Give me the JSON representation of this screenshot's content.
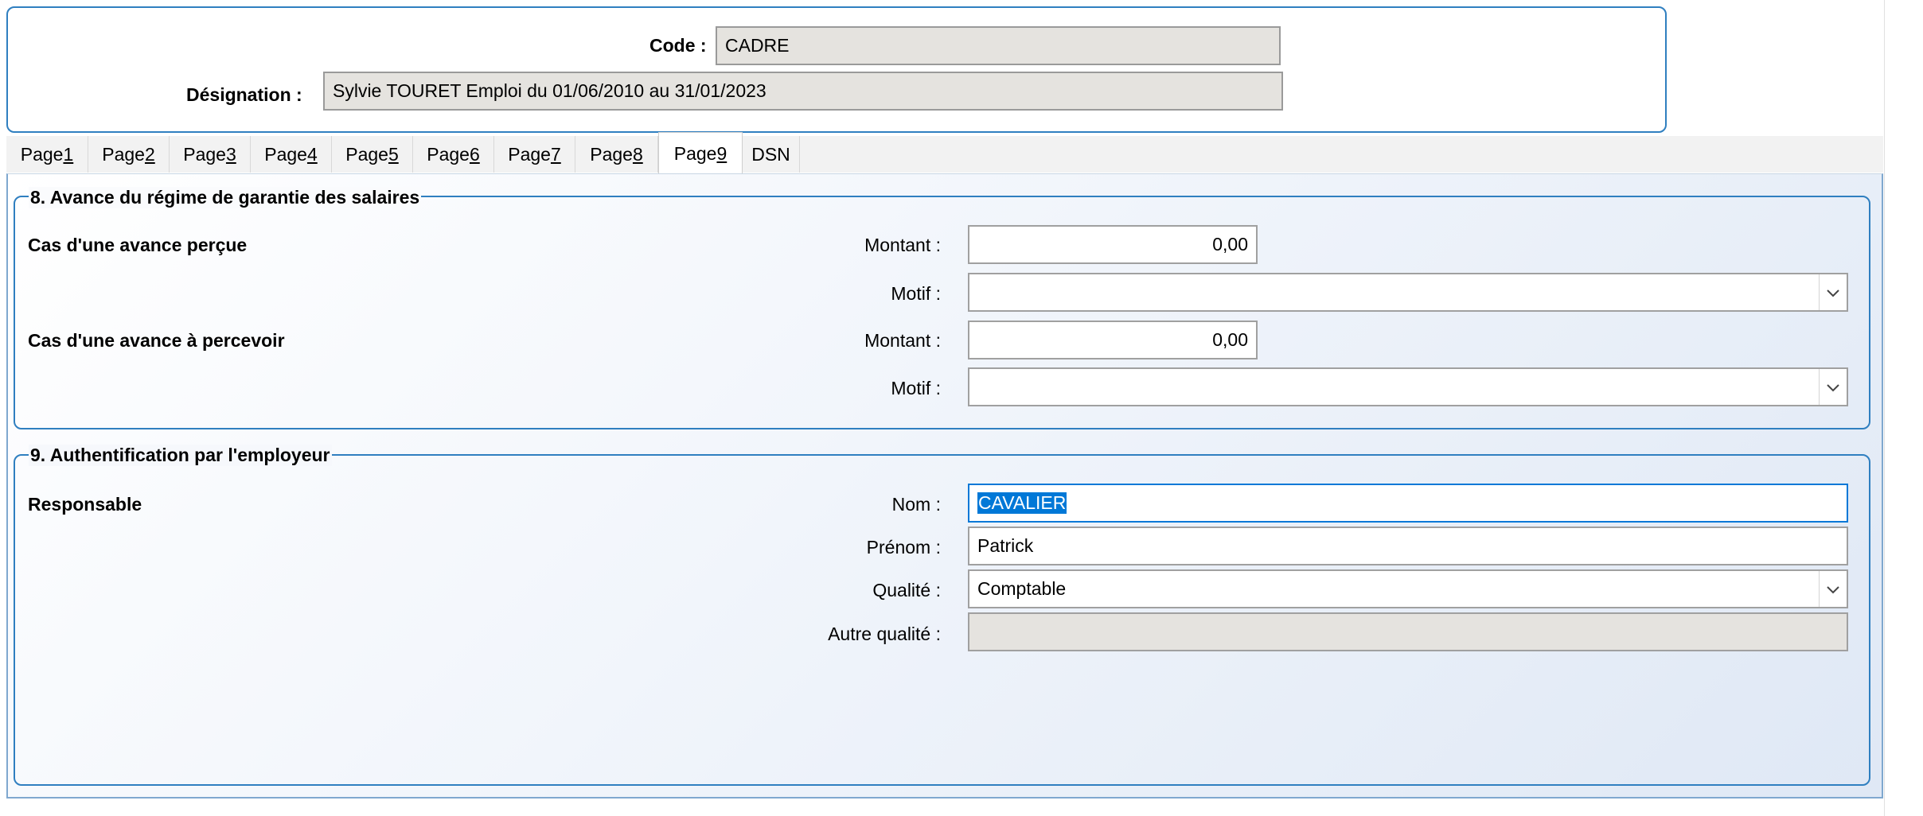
{
  "header": {
    "code_label": "Code :",
    "code_value": "CADRE",
    "designation_label": "Désignation :",
    "designation_value": "Sylvie TOURET Emploi du 01/06/2010 au 31/01/2023"
  },
  "tabs": [
    {
      "prefix": "Page ",
      "key": "1",
      "rest": ""
    },
    {
      "prefix": "Page ",
      "key": "2",
      "rest": ""
    },
    {
      "prefix": "Page ",
      "key": "3",
      "rest": ""
    },
    {
      "prefix": "Page ",
      "key": "4",
      "rest": ""
    },
    {
      "prefix": "Page ",
      "key": "5",
      "rest": ""
    },
    {
      "prefix": "Page ",
      "key": "6",
      "rest": ""
    },
    {
      "prefix": "Page ",
      "key": "7",
      "rest": ""
    },
    {
      "prefix": "Page ",
      "key": "8",
      "rest": ""
    },
    {
      "prefix": "Page ",
      "key": "9",
      "rest": ""
    },
    {
      "prefix": "DSN",
      "key": "",
      "rest": ""
    }
  ],
  "active_tab": "Page 9",
  "section8": {
    "title": "8. Avance du régime de garantie des salaires",
    "avance_percue_label": "Cas d'une avance perçue",
    "avance_percevoir_label": "Cas d'une avance à percevoir",
    "montant_label": "Montant :",
    "motif_label": "Motif :",
    "montant_percue": "0,00",
    "motif_percue": "",
    "montant_percevoir": "0,00",
    "motif_percevoir": ""
  },
  "section9": {
    "title": "9. Authentification par l'employeur",
    "responsable_label": "Responsable",
    "nom_label": "Nom :",
    "nom_value": "CAVALIER",
    "prenom_label": "Prénom :",
    "prenom_value": "Patrick",
    "qualite_label": "Qualité :",
    "qualite_value": "Comptable",
    "autre_qualite_label": "Autre qualité :",
    "autre_qualite_value": ""
  },
  "icons": {
    "combo_arrow": "chevron-down-icon"
  },
  "colors": {
    "accent_border": "#2f7fc0",
    "selection": "#0078d7",
    "readonly_bg": "#e5e3df"
  }
}
